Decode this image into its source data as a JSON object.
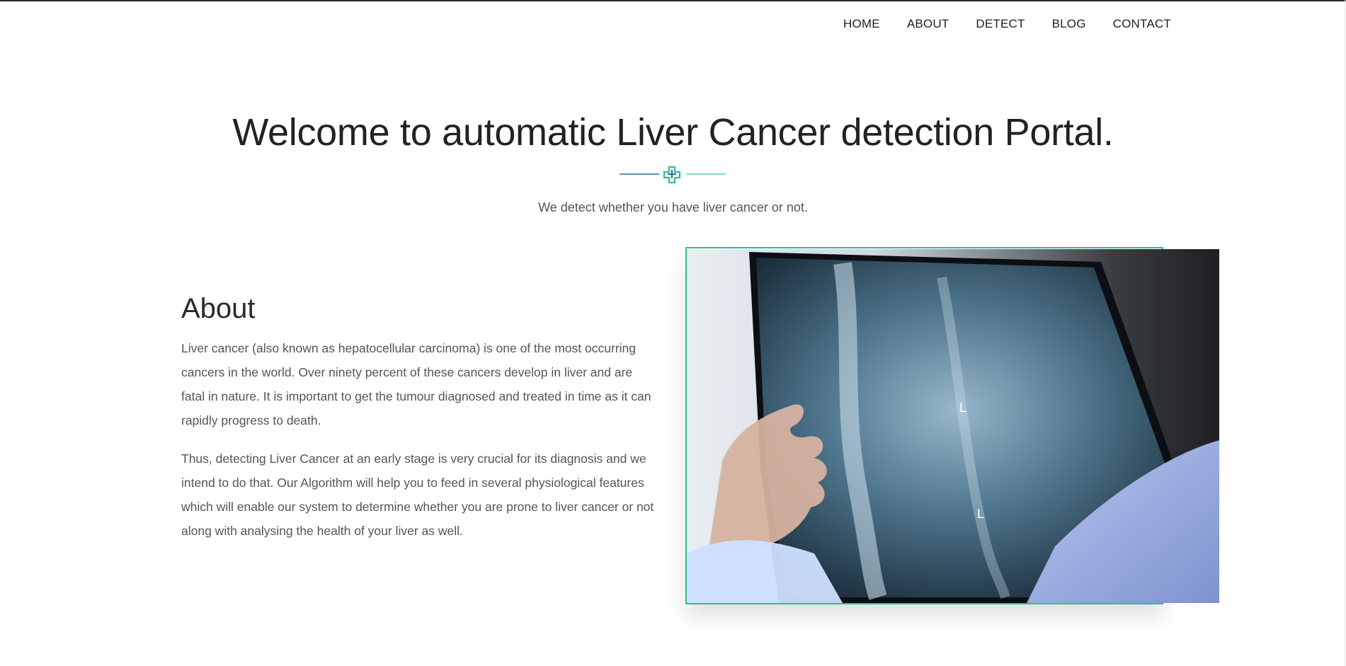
{
  "nav": {
    "items": [
      {
        "label": "HOME"
      },
      {
        "label": "ABOUT"
      },
      {
        "label": "DETECT"
      },
      {
        "label": "BLOG"
      },
      {
        "label": "CONTACT"
      }
    ]
  },
  "hero": {
    "title": "Welcome to automatic Liver Cancer detection Portal.",
    "subtitle": "We detect whether you have liver cancer or not."
  },
  "about": {
    "title": "About",
    "paragraphs": [
      "Liver cancer (also known as hepatocellular carcinoma) is one of the most occurring cancers in the world. Over ninety percent of these cancers develop in liver and are fatal in nature. It is important to get the tumour diagnosed and treated in time as it can rapidly progress to death.",
      "Thus, detecting Liver Cancer at an early stage is very crucial for its diagnosis and we intend to do that. Our Algorithm will help you to feed in several physiological features which will enable our system to determine whether you are prone to liver cancer or not along with analysing the health of your liver as well."
    ]
  },
  "colors": {
    "accent_green": "#2fbf8f",
    "accent_blue": "#2f6f9f"
  },
  "icons": {
    "divider": "medical-cross-icon"
  }
}
